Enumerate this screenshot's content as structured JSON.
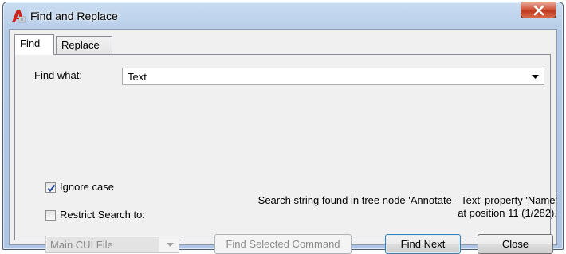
{
  "window": {
    "title": "Find and Replace",
    "close_symbol": "✕"
  },
  "tabs": [
    {
      "label": "Find",
      "active": true
    },
    {
      "label": "Replace",
      "active": false
    }
  ],
  "find": {
    "label": "Find what:",
    "value": "Text"
  },
  "options": {
    "ignore_case": {
      "label": "Ignore case",
      "checked": true
    },
    "restrict_search": {
      "label": "Restrict Search to:",
      "checked": false
    }
  },
  "scope_dropdown": {
    "value": "Main CUI File",
    "enabled": false
  },
  "status": {
    "line1": "Search string found in tree node 'Annotate - Text' property 'Name'",
    "line2": "at position 11 (1/282)."
  },
  "buttons": {
    "find_selected": "Find Selected Command",
    "find_next": "Find Next",
    "close": "Close"
  },
  "colors": {
    "title_gradient_top": "#c9dcf1",
    "close_button": "#c1381d",
    "app_icon": "#d0231b",
    "default_button_border": "#3c7fb1"
  },
  "icons": {
    "app": "autocad-app-icon",
    "close": "close-icon",
    "dropdown": "chevron-down-icon",
    "check": "check-icon"
  }
}
